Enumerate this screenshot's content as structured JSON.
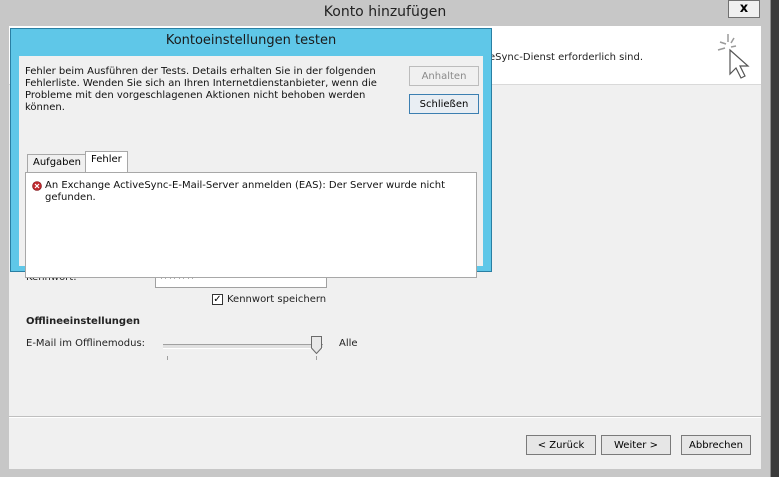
{
  "outer_window": {
    "title": "Konto hinzufügen",
    "close_label": "x",
    "header_description": "eSync-Dienst erforderlich sind."
  },
  "form": {
    "password_label": "Kennwort:",
    "password_value": "********",
    "remember_password_label": "Kennwort speichern",
    "remember_password_checked": true,
    "offline_section_title": "Offlineeinstellungen",
    "offline_mail_label": "E-Mail im Offlinemodus:",
    "offline_mail_value": "Alle"
  },
  "wizard_buttons": {
    "back": "< Zurück",
    "next": "Weiter >",
    "cancel": "Abbrechen"
  },
  "dialog": {
    "title": "Kontoeinstellungen testen",
    "message": "Fehler beim Ausführen der Tests. Details erhalten Sie in der folgenden Fehlerliste. Wenden Sie sich an Ihren Internetdienstanbieter, wenn die Probleme mit den vorgeschlagenen Aktionen nicht behoben werden können.",
    "stop_button": "Anhalten",
    "close_button": "Schließen",
    "tabs": [
      {
        "label": "Aufgaben",
        "active": false
      },
      {
        "label": "Fehler",
        "active": true
      }
    ],
    "errors": [
      {
        "text": "An Exchange ActiveSync-E-Mail-Server anmelden (EAS): Der Server wurde nicht gefunden.",
        "icon": "error-icon"
      }
    ]
  },
  "colors": {
    "dialog_frame": "#5fc7e8",
    "error_red": "#c0282d"
  }
}
